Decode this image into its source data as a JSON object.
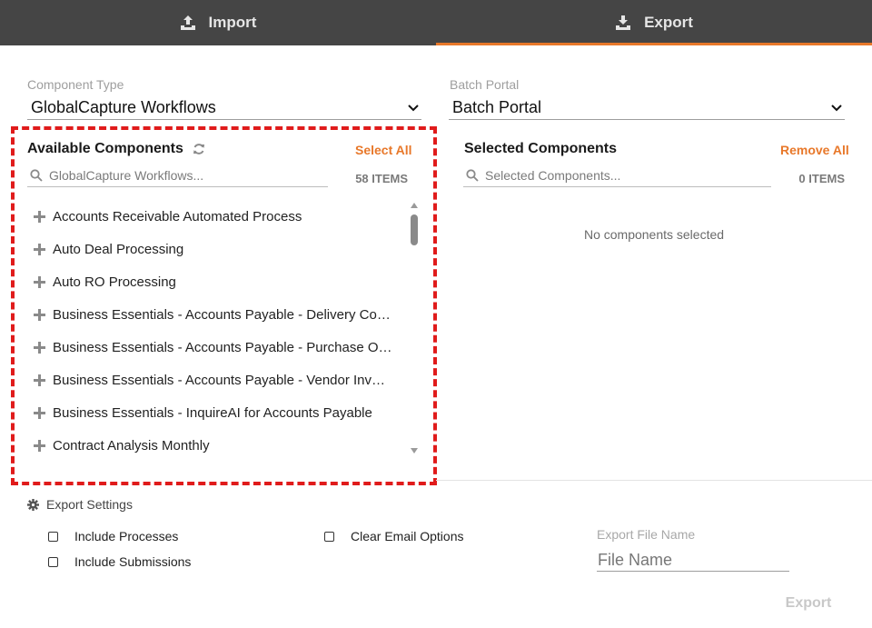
{
  "tabs": [
    {
      "label": "Import",
      "icon": "upload-icon",
      "active": false
    },
    {
      "label": "Export",
      "icon": "download-icon",
      "active": true
    }
  ],
  "colors": {
    "tab_bar": "#454545",
    "accent": "#e8782a",
    "highlight_border": "#e01b1b"
  },
  "component_type": {
    "label": "Component Type",
    "value": "GlobalCapture Workflows"
  },
  "batch_portal": {
    "label": "Batch Portal",
    "value": "Batch Portal"
  },
  "available": {
    "title": "Available Components",
    "select_all": "Select All",
    "search_placeholder": "GlobalCapture Workflows...",
    "count": "58 ITEMS",
    "items": [
      "Accounts Receivable Automated Process",
      "Auto Deal Processing",
      "Auto RO Processing",
      "Business Essentials - Accounts Payable - Delivery Co…",
      "Business Essentials - Accounts Payable - Purchase O…",
      "Business Essentials - Accounts Payable - Vendor Invo…",
      "Business Essentials - InquireAI for Accounts Payable",
      "Contract Analysis Monthly"
    ]
  },
  "selected": {
    "title": "Selected Components",
    "remove_all": "Remove All",
    "search_placeholder": "Selected Components...",
    "count": "0 ITEMS",
    "empty_message": "No components selected"
  },
  "export_settings": {
    "title": "Export Settings",
    "options": {
      "include_processes": "Include Processes",
      "include_submissions": "Include Submissions",
      "clear_email": "Clear Email Options"
    },
    "file_name_label": "Export File Name",
    "file_name_placeholder": "File Name",
    "export_button": "Export"
  }
}
